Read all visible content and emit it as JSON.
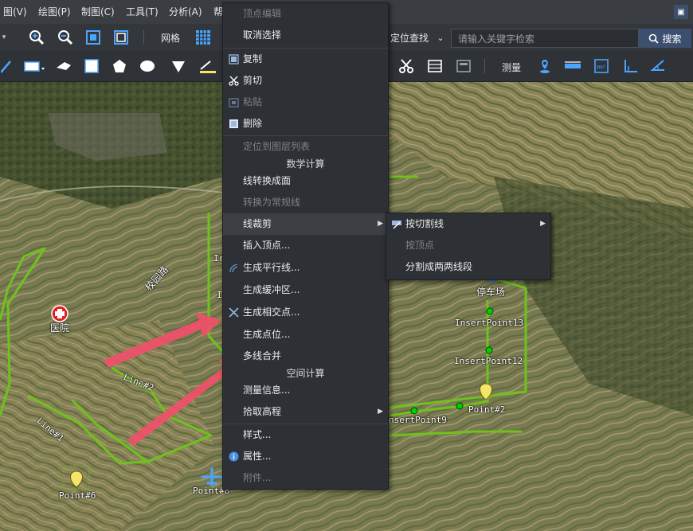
{
  "menubar": {
    "items": [
      "图(V)",
      "绘图(P)",
      "制图(C)",
      "工具(T)",
      "分析(A)",
      "帮"
    ]
  },
  "toolbar": {
    "grid_label": "网格",
    "locate_label": "定位查找",
    "search_placeholder": "请输入关键字检索",
    "search_button": "搜索",
    "measure_label": "测量"
  },
  "context_menu": {
    "items": [
      {
        "label": "顶点编辑",
        "disabled": true,
        "icon": ""
      },
      {
        "label": "取消选择",
        "disabled": false,
        "icon": ""
      },
      {
        "label": "复制",
        "disabled": false,
        "icon": "copy-icon"
      },
      {
        "label": "剪切",
        "disabled": false,
        "icon": "scissors-icon"
      },
      {
        "label": "粘贴",
        "disabled": true,
        "icon": "paste-icon"
      },
      {
        "label": "删除",
        "disabled": false,
        "icon": "delete-icon"
      },
      {
        "label": "定位到图层列表",
        "disabled": true,
        "icon": ""
      },
      {
        "label": "线转换成面",
        "disabled": false,
        "icon": ""
      },
      {
        "label": "转换为常规线",
        "disabled": true,
        "icon": ""
      },
      {
        "label": "线裁剪",
        "disabled": false,
        "icon": "",
        "submenu": true
      },
      {
        "label": "插入顶点...",
        "disabled": false,
        "icon": ""
      },
      {
        "label": "生成平行线...",
        "disabled": false,
        "icon": "parallel-line-icon"
      },
      {
        "label": "生成缓冲区...",
        "disabled": false,
        "icon": ""
      },
      {
        "label": "生成相交点...",
        "disabled": false,
        "icon": "intersect-icon"
      },
      {
        "label": "生成点位...",
        "disabled": false,
        "icon": ""
      },
      {
        "label": "多线合并",
        "disabled": false,
        "icon": ""
      },
      {
        "label": "测量信息...",
        "disabled": false,
        "icon": ""
      },
      {
        "label": "拾取高程",
        "disabled": false,
        "icon": "",
        "submenu": true
      },
      {
        "label": "样式...",
        "disabled": false,
        "icon": ""
      },
      {
        "label": "属性...",
        "disabled": false,
        "icon": "info-icon"
      },
      {
        "label": "附件...",
        "disabled": true,
        "icon": ""
      }
    ],
    "sections": {
      "math": "数学计算",
      "spatial": "空间计算"
    }
  },
  "submenu": {
    "items": [
      {
        "label": "按切割线",
        "disabled": false,
        "icon": "cut-line-icon",
        "submenu": true
      },
      {
        "label": "按顶点",
        "disabled": true,
        "icon": ""
      },
      {
        "label": "分割成两两线段",
        "disabled": false,
        "icon": ""
      }
    ]
  },
  "map": {
    "labels": {
      "point6": "Point#6",
      "point8": "Point#8",
      "point2": "Point#2",
      "line1": "Line#1",
      "line2": "Line#2",
      "insert13": "InsertPoint13",
      "insert12": "InsertPoint12",
      "insert9": "nsertPoint9",
      "hospital": "医院",
      "road": "校园路",
      "parking": "停车场",
      "frag1": "Ir",
      "frag2": "I"
    }
  },
  "colors": {
    "menu_bg": "#2d3035",
    "line_color": "#6fc21d",
    "arrow_color": "#f0506a",
    "accent": "#3c4f6e"
  }
}
